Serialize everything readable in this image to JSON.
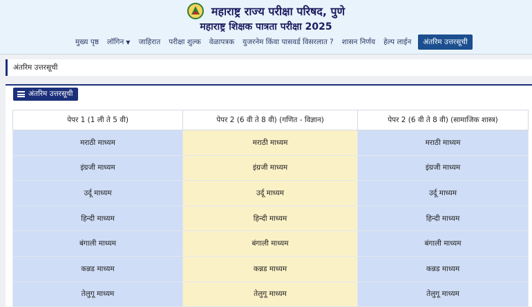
{
  "header": {
    "org_title": "महाराष्ट्र राज्य परीक्षा परिषद, पुणे",
    "exam_title": "महाराष्ट्र शिक्षक पात्रता परीक्षा 2025",
    "nav": [
      {
        "label": "मुख्य पृष्ठ"
      },
      {
        "label": "लॉगिन",
        "dropdown": true
      },
      {
        "label": "जाहिरात"
      },
      {
        "label": "परीक्षा शुल्क"
      },
      {
        "label": "वेळापत्रक"
      },
      {
        "label": "युजरनेम किंवा पासवर्ड विसरलात ?"
      },
      {
        "label": "शासन निर्णय"
      },
      {
        "label": "हेल्प लाईन"
      },
      {
        "label": "अंतरिम उत्तरसूची",
        "active": true
      }
    ]
  },
  "breadcrumb": "अंतरिम उत्तरसूची",
  "panel": {
    "button_label": "अंतरिम उत्तरसूची",
    "columns": [
      "पेपर 1 (1 ली ते 5 वी)",
      "पेपर 2 (6 वी ते 8 वी) (गणित - विज्ञान)",
      "पेपर 2 (6 वी ते 8 वी) (सामाजिक शास्त्र)"
    ],
    "rows": [
      [
        "मराठी माध्यम",
        "मराठी माध्यम",
        "मराठी माध्यम"
      ],
      [
        "इंग्रजी माध्यम",
        "इंग्रजी माध्यम",
        "इंग्रजी माध्यम"
      ],
      [
        "उर्दू माध्यम",
        "उर्दू माध्यम",
        "उर्दू माध्यम"
      ],
      [
        "हिन्दी माध्यम",
        "हिन्दी माध्यम",
        "हिन्दी माध्यम"
      ],
      [
        "बंगाली माध्यम",
        "बंगाली माध्यम",
        "बंगाली माध्यम"
      ],
      [
        "कन्नड माध्यम",
        "कन्नड माध्यम",
        "कन्नड माध्यम"
      ],
      [
        "तेलुगू माध्यम",
        "तेलुगू माध्यम",
        "तेलुगू माध्यम"
      ]
    ]
  },
  "icons": {
    "logo": "emblem-logo-icon",
    "panel_button": "list-icon",
    "dropdown": "caret-down-icon"
  },
  "colors": {
    "primary": "#1b2f7a",
    "nav_active": "#1b4f8f",
    "col_blue": "#cfddf6",
    "col_yellow": "#fbf1c7"
  }
}
